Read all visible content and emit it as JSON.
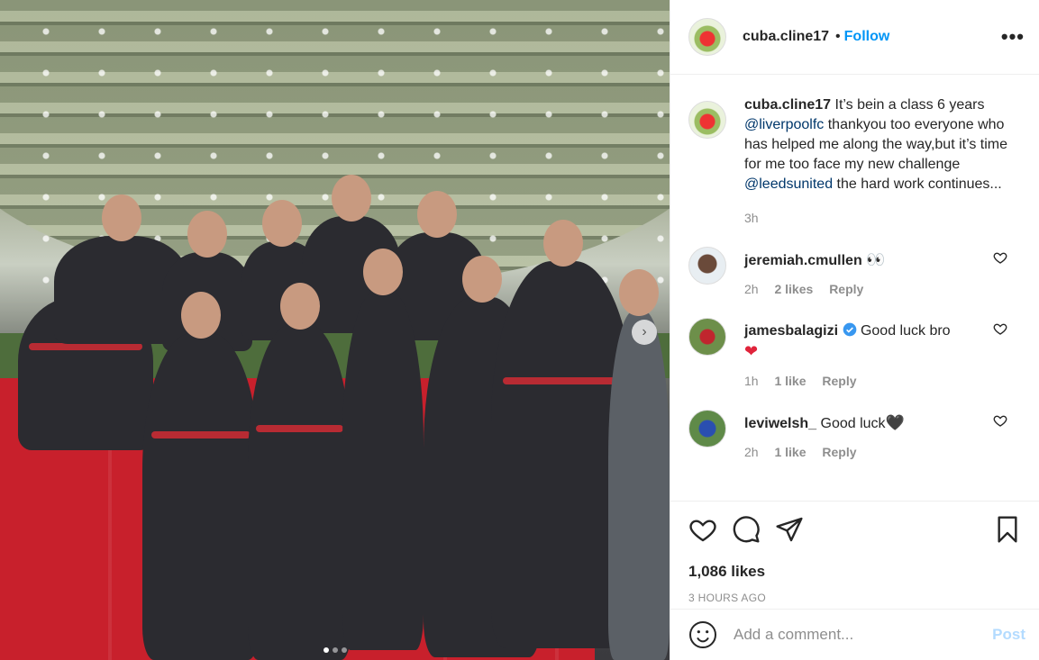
{
  "post": {
    "author": "cuba.cline17",
    "follow_label": "Follow",
    "separator": "•",
    "more_label": "•••"
  },
  "caption": {
    "author": "cuba.cline17",
    "part1": " It’s bein a class 6 years ",
    "mention1": "@liverpoolfc",
    "part2": " thankyou too everyone who has helped me along the way,but it’s time for me too face my new challenge ",
    "mention2": "@leedsunited",
    "part3": " the hard work continues...",
    "time": "3h"
  },
  "comments": [
    {
      "user": "jeremiah.cmullen",
      "text": "",
      "emoji": "👀",
      "time": "2h",
      "likes": "2 likes",
      "reply": "Reply"
    },
    {
      "user": "jamesbalagizi",
      "verified": true,
      "text": "Good luck bro",
      "emoji": "❤",
      "time": "1h",
      "likes": "1 like",
      "reply": "Reply"
    },
    {
      "user": "leviwelsh_",
      "text": "Good luck",
      "emoji": "🖤",
      "time": "2h",
      "likes": "1 like",
      "reply": "Reply"
    }
  ],
  "actions": {
    "likes": "1,086 likes",
    "timestamp": "3 HOURS AGO"
  },
  "add_comment": {
    "placeholder": "Add a comment...",
    "post_label": "Post"
  },
  "icons": [
    "like-icon",
    "comment-icon",
    "share-icon",
    "bookmark-icon",
    "emoji-icon",
    "heart-small-icon",
    "verified-icon"
  ]
}
